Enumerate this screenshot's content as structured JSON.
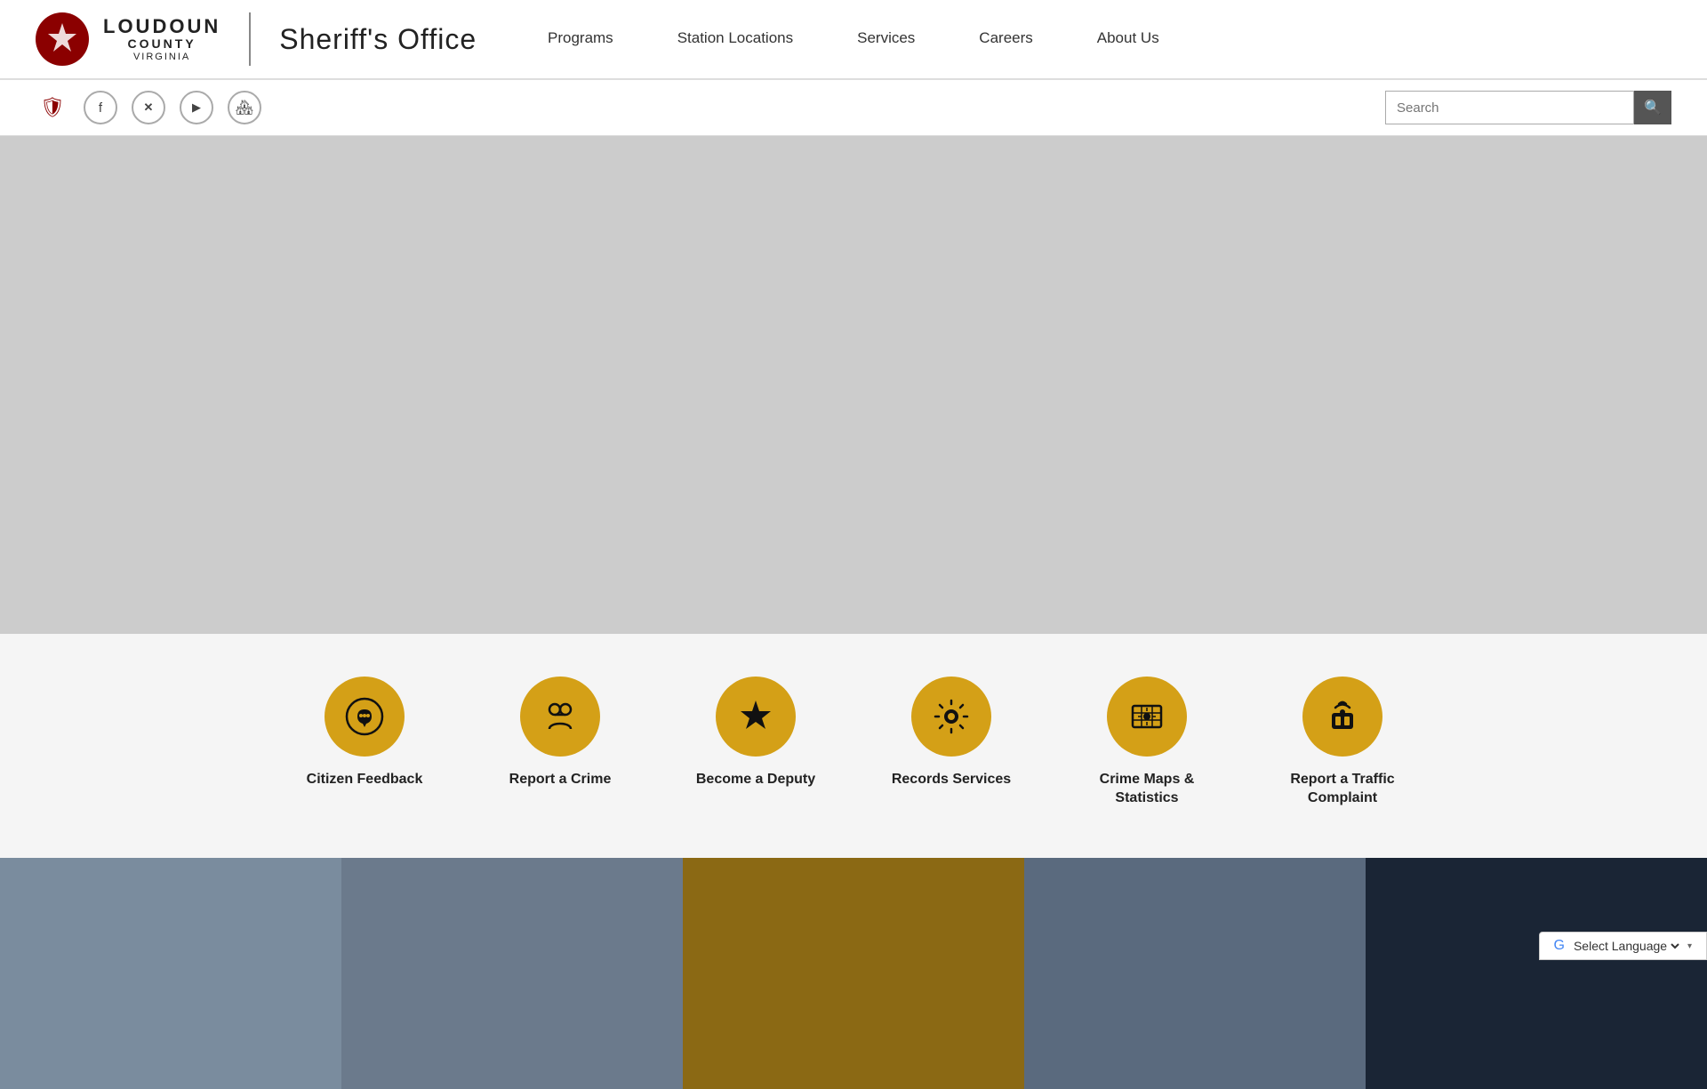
{
  "header": {
    "logo": {
      "loudoun": "LOUDOUN",
      "county": "COUNTY",
      "virginia": "VIRGINIA",
      "sheriffs_office": "Sheriff's Office"
    },
    "nav": [
      {
        "id": "programs",
        "label": "Programs"
      },
      {
        "id": "station-locations",
        "label": "Station Locations"
      },
      {
        "id": "services",
        "label": "Services"
      },
      {
        "id": "careers",
        "label": "Careers"
      },
      {
        "id": "about-us",
        "label": "About Us"
      }
    ]
  },
  "toolbar": {
    "social": [
      {
        "id": "shield",
        "icon": "🛡",
        "label": "Loudoun County Shield"
      },
      {
        "id": "facebook",
        "icon": "f",
        "label": "Facebook"
      },
      {
        "id": "twitter",
        "icon": "𝕏",
        "label": "Twitter/X"
      },
      {
        "id": "youtube",
        "icon": "▶",
        "label": "YouTube"
      },
      {
        "id": "nextdoor",
        "icon": "🏠",
        "label": "Nextdoor"
      }
    ],
    "search_placeholder": "Search"
  },
  "quick_links": [
    {
      "id": "citizen-feedback",
      "label": "Citizen Feedback",
      "icon": "📞"
    },
    {
      "id": "report-crime",
      "label": "Report a Crime",
      "icon": "⛓"
    },
    {
      "id": "become-deputy",
      "label": "Become a Deputy",
      "icon": "⭐"
    },
    {
      "id": "records-services",
      "label": "Records Services",
      "icon": "🔨"
    },
    {
      "id": "crime-maps",
      "label": "Crime Maps & Statistics",
      "icon": "🗺"
    },
    {
      "id": "report-traffic",
      "label": "Report a Traffic Complaint",
      "icon": "🚨"
    }
  ],
  "translate": {
    "label": "Select Language",
    "provider": "Google Translate"
  }
}
